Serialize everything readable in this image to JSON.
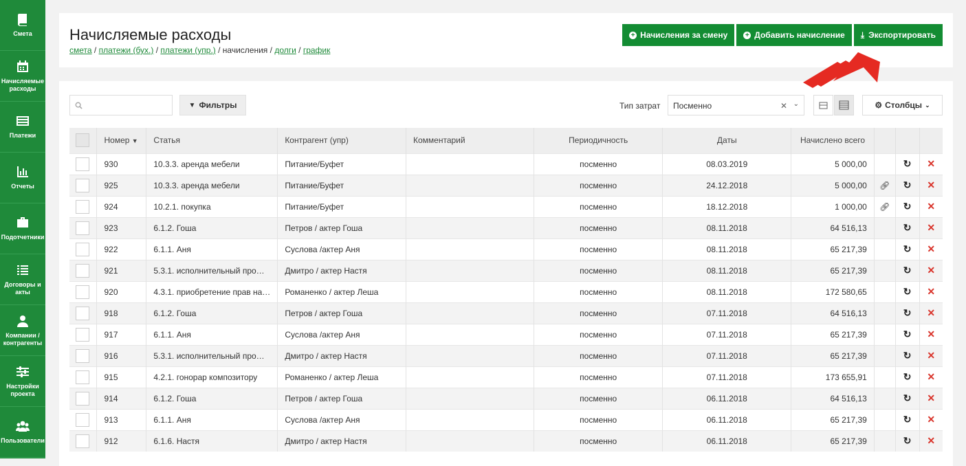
{
  "sidebar": {
    "items": [
      {
        "label": "Смета",
        "icon": "book-icon"
      },
      {
        "label": "Начисляемые расходы",
        "icon": "calendar-icon"
      },
      {
        "label": "Платежи",
        "icon": "list-icon"
      },
      {
        "label": "Отчеты",
        "icon": "bar-chart-icon"
      },
      {
        "label": "Подотчетники",
        "icon": "briefcase-icon"
      },
      {
        "label": "Договоры и акты",
        "icon": "document-list-icon"
      },
      {
        "label": "Компании / контрагенты",
        "icon": "user-icon"
      },
      {
        "label": "Настройки проекта",
        "icon": "sliders-icon"
      },
      {
        "label": "Пользователи",
        "icon": "users-icon"
      }
    ]
  },
  "header": {
    "title": "Начисляемые расходы",
    "breadcrumbs": [
      "смета",
      "платежи (бух.)",
      "платежи (упр.)",
      "начисления",
      "долги",
      "график"
    ],
    "buttons": {
      "shift": "Начисления за смену",
      "add": "Добавить начисление",
      "export": "Экспортировать"
    }
  },
  "toolbar": {
    "search_placeholder": "",
    "filters": "Фильтры",
    "cost_type_label": "Тип затрат",
    "cost_type_value": "Посменно",
    "columns": "Столбцы"
  },
  "table": {
    "headers": [
      "Номер",
      "Статья",
      "Контрагент (упр)",
      "Комментарий",
      "Периодичность",
      "Даты",
      "Начислено всего"
    ],
    "rows": [
      [
        "930",
        "10.3.3. аренда мебели",
        "Питание/Буфет",
        "",
        "посменно",
        "08.03.2019",
        "5 000,00"
      ],
      [
        "925",
        "10.3.3. аренда мебели",
        "Питание/Буфет",
        "",
        "посменно",
        "24.12.2018",
        "5 000,00"
      ],
      [
        "924",
        "10.2.1. покупка",
        "Питание/Буфет",
        "",
        "посменно",
        "18.12.2018",
        "1 000,00"
      ],
      [
        "923",
        "6.1.2. Гоша",
        "Петров / актер Гоша",
        "",
        "посменно",
        "08.11.2018",
        "64 516,13"
      ],
      [
        "922",
        "6.1.1. Аня",
        "Суслова /актер Аня",
        "",
        "посменно",
        "08.11.2018",
        "65 217,39"
      ],
      [
        "921",
        "5.3.1. исполнительный про…",
        "Дмитро / актер Настя",
        "",
        "посменно",
        "08.11.2018",
        "65 217,39"
      ],
      [
        "920",
        "4.3.1. приобретение прав на…",
        "Романенко / актер Леша",
        "",
        "посменно",
        "08.11.2018",
        "172 580,65"
      ],
      [
        "918",
        "6.1.2. Гоша",
        "Петров / актер Гоша",
        "",
        "посменно",
        "07.11.2018",
        "64 516,13"
      ],
      [
        "917",
        "6.1.1. Аня",
        "Суслова /актер Аня",
        "",
        "посменно",
        "07.11.2018",
        "65 217,39"
      ],
      [
        "916",
        "5.3.1. исполнительный про…",
        "Дмитро / актер Настя",
        "",
        "посменно",
        "07.11.2018",
        "65 217,39"
      ],
      [
        "915",
        "4.2.1. гонорар композитору",
        "Романенко / актер Леша",
        "",
        "посменно",
        "07.11.2018",
        "173 655,91"
      ],
      [
        "914",
        "6.1.2. Гоша",
        "Петров / актер Гоша",
        "",
        "посменно",
        "06.11.2018",
        "64 516,13"
      ],
      [
        "913",
        "6.1.1. Аня",
        "Суслова /актер Аня",
        "",
        "посменно",
        "06.11.2018",
        "65 217,39"
      ],
      [
        "912",
        "6.1.6. Настя",
        "Дмитро / актер Настя",
        "",
        "посменно",
        "06.11.2018",
        "65 217,39"
      ]
    ],
    "link_rows": [
      1,
      2
    ]
  }
}
